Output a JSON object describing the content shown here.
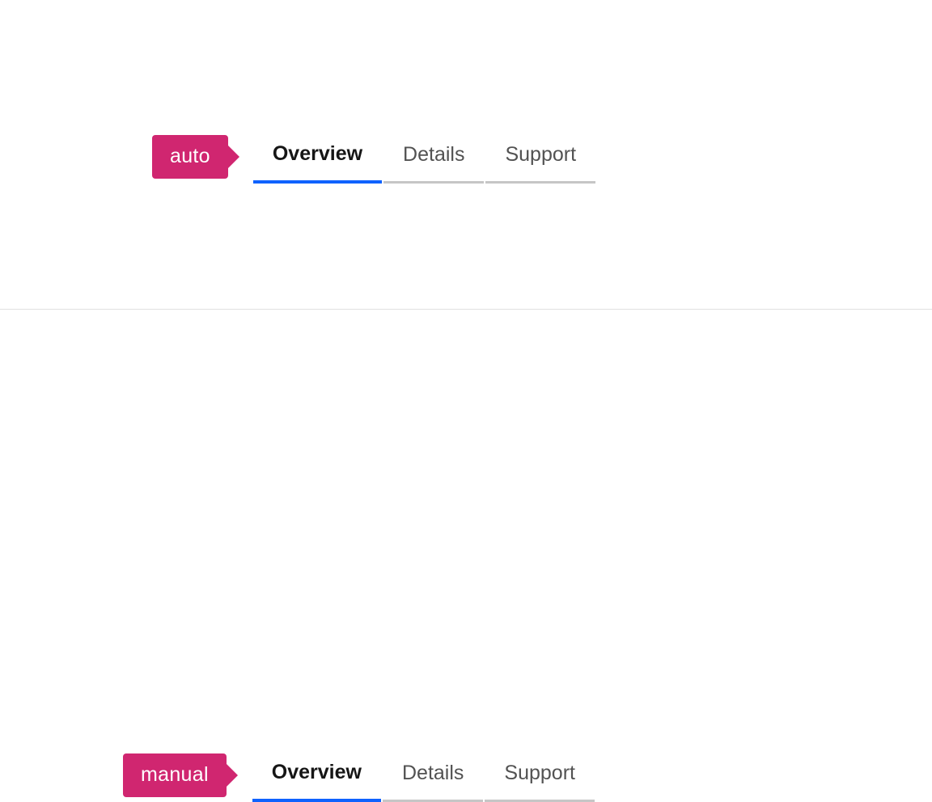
{
  "examples": [
    {
      "tag_label": "auto",
      "tabs": [
        {
          "label": "Overview",
          "active": true
        },
        {
          "label": "Details",
          "active": false
        },
        {
          "label": "Support",
          "active": false
        }
      ]
    },
    {
      "tag_label": "manual",
      "tabs": [
        {
          "label": "Overview",
          "active": true
        },
        {
          "label": "Details",
          "active": false
        },
        {
          "label": "Support",
          "active": false
        }
      ]
    }
  ]
}
